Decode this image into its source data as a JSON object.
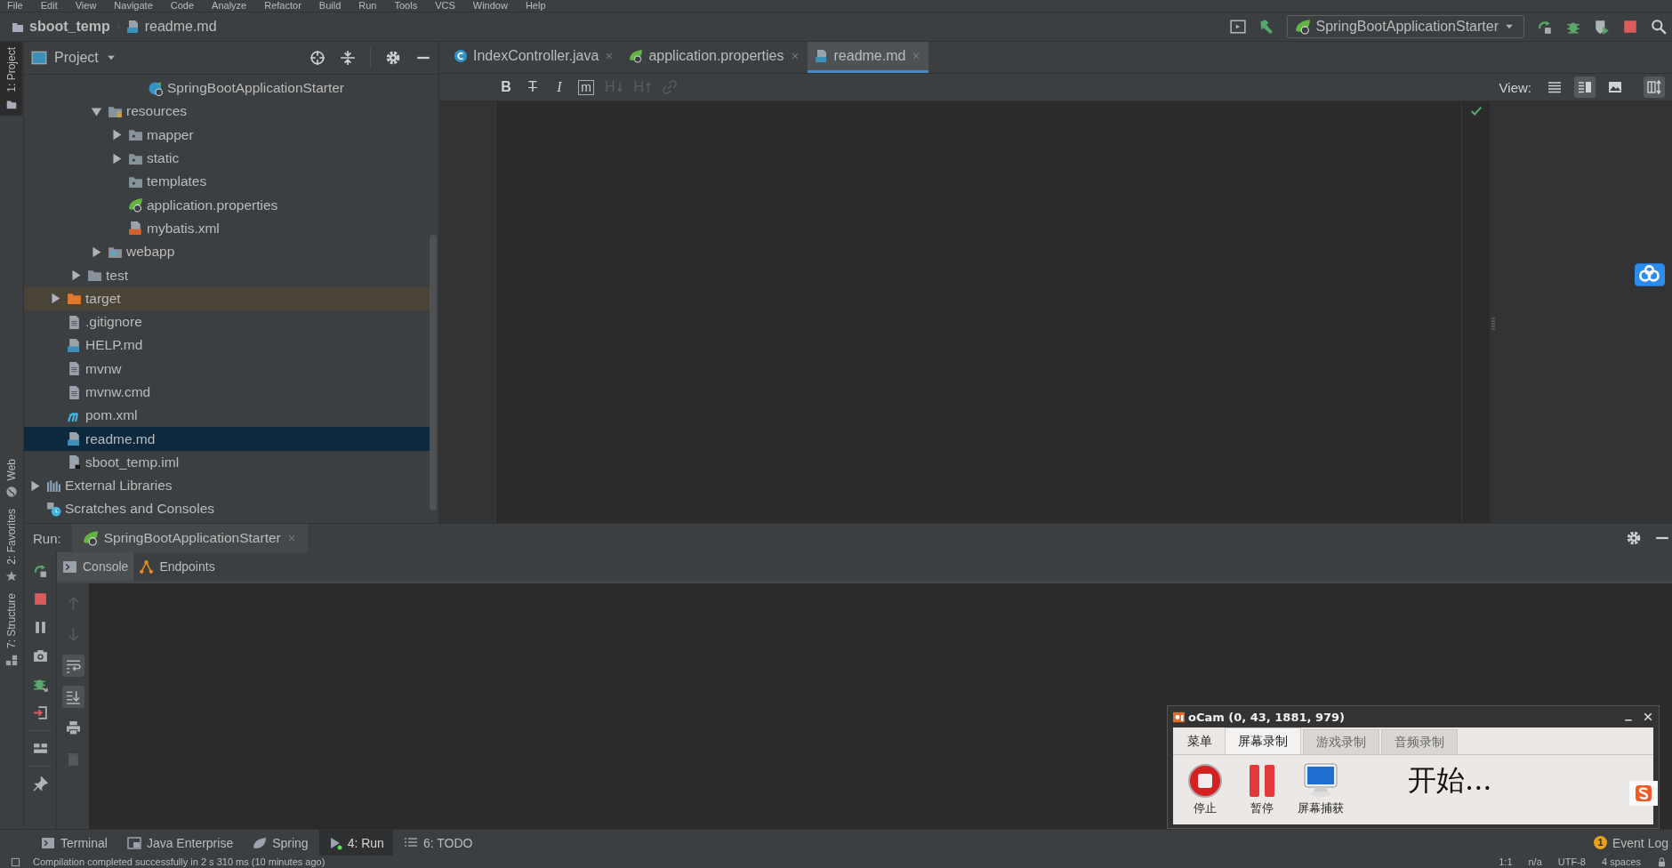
{
  "menu": [
    "File",
    "Edit",
    "View",
    "Navigate",
    "Code",
    "Analyze",
    "Refactor",
    "Build",
    "Run",
    "Tools",
    "VCS",
    "Window",
    "Help"
  ],
  "navbar": {
    "breadcrumb": [
      "sboot_temp",
      "readme.md"
    ],
    "run_config": "SpringBootApplicationStarter"
  },
  "tool_strip_left": [
    {
      "label": "1: Project",
      "kind": "project",
      "selected": true
    },
    {
      "label": "Web",
      "kind": "web",
      "selected": false
    },
    {
      "label": "2: Favorites",
      "kind": "favorites",
      "selected": false
    },
    {
      "label": "7: Structure",
      "kind": "structure",
      "selected": false
    }
  ],
  "project_panel": {
    "title": "Project",
    "tree": [
      {
        "children": [
          {
            "children": [
              {
                "children": [
                  {
                    "children": [
                      {
                        "children": [
                          {
                            "label": "SpringBootApplicationStarter",
                            "kind": "spring-class",
                            "selected": false
                          }
                        ]
                      }
                    ]
                  },
                  {
                    "label": "resources",
                    "kind": "resources-folder",
                    "expanded": true,
                    "selected": false,
                    "children": [
                      {
                        "label": "mapper",
                        "kind": "source-folder",
                        "expanded": false,
                        "selected": false
                      },
                      {
                        "label": "static",
                        "kind": "source-folder",
                        "expanded": false,
                        "selected": false
                      },
                      {
                        "label": "templates",
                        "kind": "source-folder",
                        "selected": false
                      },
                      {
                        "label": "application.properties",
                        "kind": "spring",
                        "selected": false
                      },
                      {
                        "label": "mybatis.xml",
                        "kind": "xml",
                        "selected": false
                      }
                    ]
                  },
                  {
                    "label": "webapp",
                    "kind": "web-folder",
                    "expanded": false,
                    "selected": false
                  }
                ]
              },
              {
                "label": "test",
                "kind": "folder",
                "expanded": false,
                "selected": false
              }
            ]
          },
          {
            "label": "target",
            "kind": "excluded-folder",
            "expanded": false,
            "selected": false
          },
          {
            "label": ".gitignore",
            "kind": "file",
            "selected": false
          },
          {
            "label": "HELP.md",
            "kind": "md",
            "selected": false
          },
          {
            "label": "mvnw",
            "kind": "file",
            "selected": false
          },
          {
            "label": "mvnw.cmd",
            "kind": "file",
            "selected": false
          },
          {
            "label": "pom.xml",
            "kind": "maven",
            "selected": false
          },
          {
            "label": "readme.md",
            "kind": "md",
            "selected": true
          },
          {
            "label": "sboot_temp.iml",
            "kind": "iml",
            "selected": false
          }
        ]
      },
      {
        "label": "External Libraries",
        "kind": "library",
        "expanded": false,
        "selected": false
      },
      {
        "label": "Scratches and Consoles",
        "kind": "scratch",
        "selected": false
      }
    ]
  },
  "editor": {
    "tabs": [
      {
        "label": "IndexController.java",
        "kind": "java-class",
        "selected": false
      },
      {
        "label": "application.properties",
        "kind": "spring",
        "selected": false
      },
      {
        "label": "readme.md",
        "kind": "md",
        "selected": true
      }
    ],
    "md_toolbar": [
      {
        "kind": "bold",
        "glyph": "B",
        "disabled": false
      },
      {
        "kind": "strike",
        "glyph": "T",
        "disabled": false
      },
      {
        "kind": "italic",
        "glyph": "I",
        "disabled": false
      },
      {
        "kind": "code",
        "glyph": "m",
        "disabled": false
      },
      {
        "kind": "header-down",
        "glyph": "H",
        "disabled": true
      },
      {
        "kind": "header-up",
        "glyph": "H",
        "disabled": true
      },
      {
        "kind": "link",
        "disabled": true
      }
    ],
    "view_label": "View:",
    "views": [
      {
        "kind": "editor",
        "selected": false
      },
      {
        "kind": "split",
        "selected": true
      },
      {
        "kind": "preview",
        "selected": false
      }
    ],
    "sync_scroll": {
      "on": true
    }
  },
  "run_panel": {
    "label": "Run:",
    "tab": "SpringBootApplicationStarter",
    "subtabs": [
      {
        "label": "Console",
        "kind": "console",
        "selected": true
      },
      {
        "label": "Endpoints",
        "kind": "endpoints",
        "selected": false
      }
    ],
    "toolbar_main": [
      {
        "kind": "rerun"
      },
      {
        "kind": "stop"
      },
      {
        "kind": "pause"
      },
      {
        "kind": "camera"
      },
      {
        "kind": "debug"
      },
      {
        "kind": "exit"
      },
      {
        "kind": "layout"
      },
      {
        "kind": "pin"
      }
    ],
    "toolbar_console": [
      {
        "kind": "up",
        "selected": false,
        "disabled": true
      },
      {
        "kind": "down",
        "selected": false,
        "disabled": true
      },
      {
        "kind": "wrap",
        "selected": true,
        "disabled": false
      },
      {
        "kind": "scroll-end",
        "selected": true,
        "disabled": false
      },
      {
        "kind": "print",
        "selected": false,
        "disabled": false
      },
      {
        "kind": "trash",
        "selected": false,
        "disabled": true
      }
    ]
  },
  "bottom_tabs": [
    {
      "label": "Terminal",
      "kind": "terminal",
      "selected": false
    },
    {
      "label": "Java Enterprise",
      "kind": "enterprise",
      "selected": false
    },
    {
      "label": "Spring",
      "kind": "leaf",
      "selected": false
    },
    {
      "label": "4: Run",
      "kind": "run",
      "selected": true
    },
    {
      "label": "6: TODO",
      "kind": "todo",
      "selected": false
    }
  ],
  "event_log": {
    "label": "Event Log",
    "count": "1"
  },
  "status_bar": {
    "message": "Compilation completed successfully in 2 s 310 ms (10 minutes ago)",
    "items": [
      "1:1",
      "n/a",
      "UTF-8",
      "4 spaces"
    ]
  },
  "ocam": {
    "title": "oCam (0, 43, 1881, 979)",
    "tabs": [
      {
        "label": "菜单",
        "selected": false
      },
      {
        "label": "屏幕录制",
        "selected": true
      },
      {
        "label": "游戏录制",
        "selected": false
      },
      {
        "label": "音频录制",
        "selected": false
      }
    ],
    "buttons": [
      {
        "label": "停止",
        "kind": "stop"
      },
      {
        "label": "暂停",
        "kind": "pause"
      },
      {
        "label": "屏幕捕获",
        "kind": "capture"
      }
    ],
    "status": "开始..."
  }
}
